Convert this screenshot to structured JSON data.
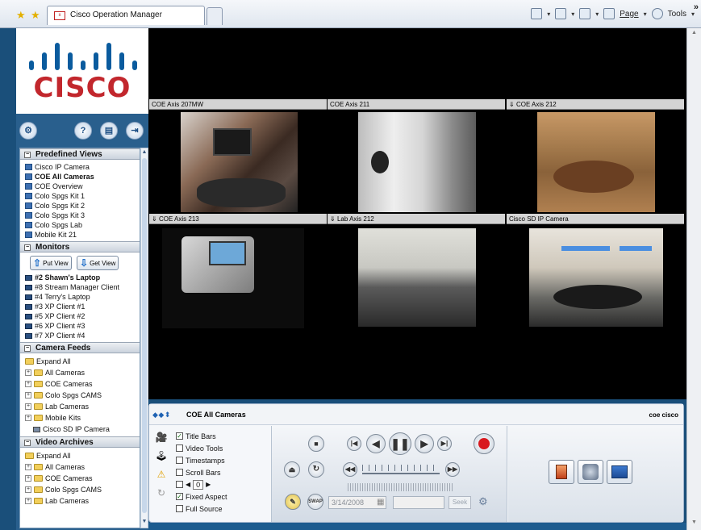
{
  "browser": {
    "tab_title": "Cisco Operation Manager",
    "page_menu": "Page",
    "tools_menu": "Tools"
  },
  "logo": {
    "text": "CISCO"
  },
  "sidebar": {
    "predefined_views": {
      "header": "Predefined Views",
      "items": [
        "Cisco IP Camera",
        "COE All Cameras",
        "COE Overview",
        "Colo Spgs Kit 1",
        "Colo Spgs Kit 2",
        "Colo Spgs Kit 3",
        "Colo Spgs Lab",
        "Mobile Kit 21"
      ]
    },
    "monitors": {
      "header": "Monitors",
      "put_view": "Put View",
      "get_view": "Get View",
      "items": [
        "#2 Shawn's Laptop",
        "#8 Stream Manager Client",
        "#4 Terry's Laptop",
        "#3 XP Client #1",
        "#5 XP Client #2",
        "#6 XP Client #3",
        "#7 XP Client #4"
      ]
    },
    "camera_feeds": {
      "header": "Camera Feeds",
      "items": [
        "Expand All",
        "All Cameras",
        "COE Cameras",
        "Colo Spgs CAMS",
        "Lab Cameras",
        "Mobile Kits",
        "Cisco SD IP Camera"
      ]
    },
    "video_archives": {
      "header": "Video Archives",
      "items": [
        "Expand All",
        "All Cameras",
        "COE Cameras",
        "Colo Spgs CAMS",
        "Lab Cameras"
      ]
    }
  },
  "cameras": [
    {
      "title": "COE Axis 207MW"
    },
    {
      "title": "COE Axis 211"
    },
    {
      "title": "COE Axis 212"
    },
    {
      "title": "COE Axis 213"
    },
    {
      "title": "Lab Axis 212"
    },
    {
      "title": "Cisco SD IP Camera"
    }
  ],
  "control": {
    "view_title": "COE All Cameras",
    "user": "coe cisco",
    "options": [
      {
        "label": "Title Bars",
        "checked": true
      },
      {
        "label": "Video Tools",
        "checked": false
      },
      {
        "label": "Timestamps",
        "checked": false
      },
      {
        "label": "Scroll Bars",
        "checked": false
      },
      {
        "label": "0",
        "checked": false
      },
      {
        "label": "Fixed Aspect",
        "checked": true
      },
      {
        "label": "Full Source",
        "checked": false
      }
    ],
    "date": "3/14/2008",
    "seek": "Seek",
    "swap": "SWAP"
  },
  "colors": {
    "cisco_red": "#c2272d",
    "cisco_blue": "#0a5b9e",
    "record_red": "#d8181e"
  }
}
